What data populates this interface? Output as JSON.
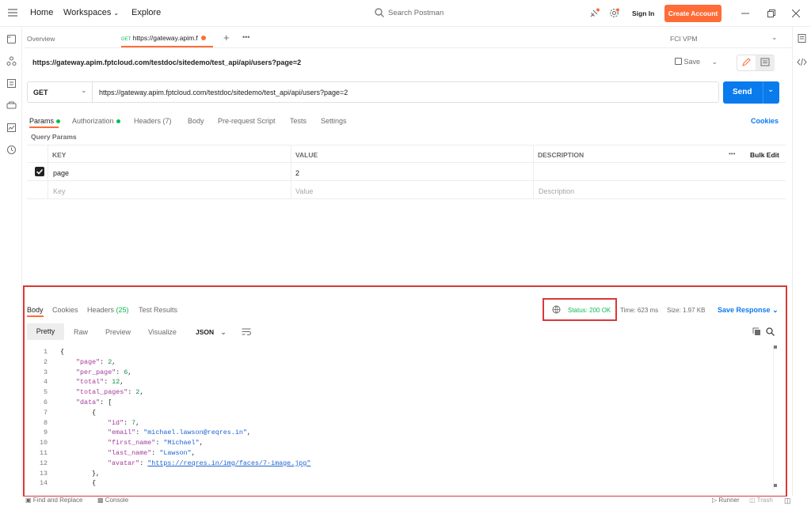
{
  "topbar": {
    "home": "Home",
    "workspaces": "Workspaces",
    "explore": "Explore",
    "search_placeholder": "Search Postman",
    "sign_in": "Sign In",
    "create_account": "Create Account"
  },
  "tabs": {
    "overview": "Overview",
    "active_method": "GET",
    "active_url": "https://gateway.apim.f",
    "environment": "FCI VPM"
  },
  "request": {
    "title": "https://gateway.apim.fptcloud.com/testdoc/sitedemo/test_api/api/users?page=2",
    "save": "Save",
    "method": "GET",
    "url": "https://gateway.apim.fptcloud.com/testdoc/sitedemo/test_api/api/users?page=2",
    "send": "Send"
  },
  "req_tabs": {
    "params": "Params",
    "authorization": "Authorization",
    "headers": "Headers",
    "headers_count": "(7)",
    "body": "Body",
    "prerequest": "Pre-request Script",
    "tests": "Tests",
    "settings": "Settings",
    "cookies": "Cookies"
  },
  "query": {
    "title": "Query Params",
    "col_key": "KEY",
    "col_value": "VALUE",
    "col_description": "DESCRIPTION",
    "bulk_edit": "Bulk Edit",
    "row_key": "page",
    "row_value": "2",
    "ph_key": "Key",
    "ph_value": "Value",
    "ph_description": "Description"
  },
  "response": {
    "body": "Body",
    "cookies": "Cookies",
    "headers": "Headers",
    "headers_count": "(25)",
    "test_results": "Test Results",
    "status": "Status: 200 OK",
    "time": "Time: 623 ms",
    "size": "Size: 1.97 KB",
    "save_response": "Save Response",
    "pretty": "Pretty",
    "raw": "Raw",
    "preview": "Preview",
    "visualize": "Visualize",
    "format": "JSON"
  },
  "code_lines": [
    {
      "n": "1",
      "t": "{"
    },
    {
      "n": "2",
      "k": "\"page\"",
      "s": ": ",
      "v": "2",
      "e": ","
    },
    {
      "n": "3",
      "k": "\"per_page\"",
      "s": ": ",
      "v": "6",
      "e": ","
    },
    {
      "n": "4",
      "k": "\"total\"",
      "s": ": ",
      "v": "12",
      "e": ","
    },
    {
      "n": "5",
      "k": "\"total_pages\"",
      "s": ": ",
      "v": "2",
      "e": ","
    },
    {
      "n": "6",
      "k": "\"data\"",
      "s": ": ",
      "t2": "["
    },
    {
      "n": "7",
      "t": "{"
    },
    {
      "n": "8",
      "k": "\"id\"",
      "s": ": ",
      "v": "7",
      "e": ","
    },
    {
      "n": "9",
      "k": "\"email\"",
      "s": ": ",
      "str": "\"michael.lawson@reqres.in\"",
      "e": ","
    },
    {
      "n": "10",
      "k": "\"first_name\"",
      "s": ": ",
      "str": "\"Michael\"",
      "e": ","
    },
    {
      "n": "11",
      "k": "\"last_name\"",
      "s": ": ",
      "str": "\"Lawson\"",
      "e": ","
    },
    {
      "n": "12",
      "k": "\"avatar\"",
      "s": ": ",
      "link": "\"https://reqres.in/img/faces/7-image.jpg\""
    },
    {
      "n": "13",
      "t": "},"
    },
    {
      "n": "14",
      "t": "{"
    }
  ],
  "footer": {
    "find_replace": "Find and Replace",
    "console": "Console",
    "runner": "Runner",
    "trash": "Trash"
  }
}
